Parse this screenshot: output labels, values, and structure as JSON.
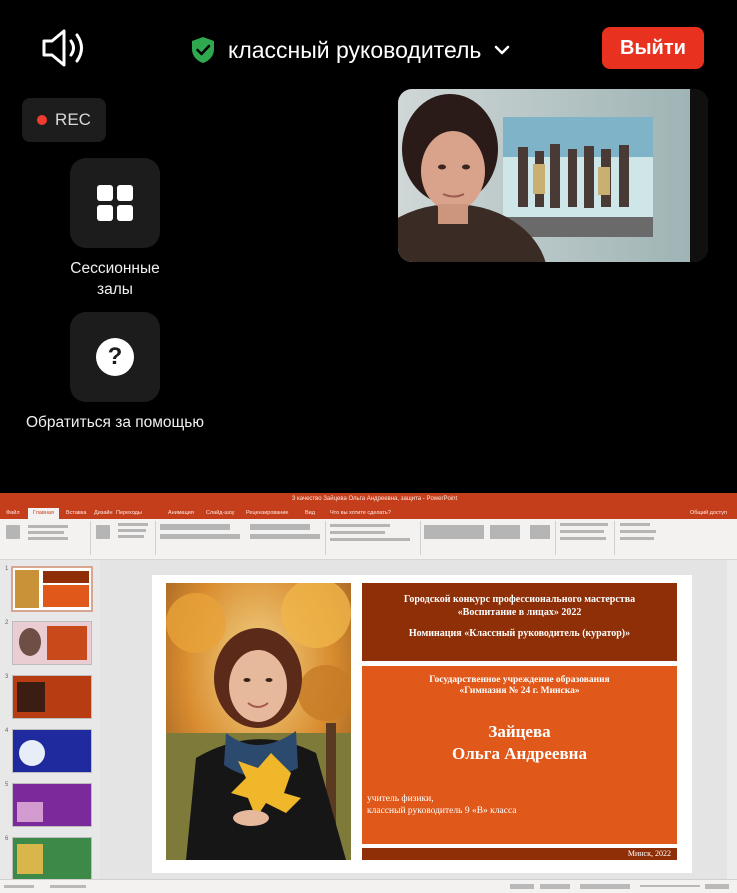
{
  "meeting": {
    "title": "классный руководитель",
    "exit_label": "Выйти",
    "rec_label": "REC",
    "breakout_label": "Сессионные залы",
    "help_label": "Обратиться за помощью",
    "help_glyph": "?",
    "icons": [
      "speaker-icon",
      "shield-check-icon",
      "chevron-down-icon",
      "grid-icon",
      "question-icon"
    ]
  },
  "colors": {
    "exit": "#e8321f",
    "rec_dot": "#f23c2e",
    "shield": "#2fa84f",
    "pp_accent": "#c43e1c",
    "slide_dark": "#8e2f08",
    "slide_orange": "#e0591a"
  },
  "powerpoint": {
    "window_title": "3 качество Зайцева Ольга Андреевна, защита  -  PowerPoint",
    "tabs": [
      "Файл",
      "Главная",
      "Вставка",
      "Дизайн",
      "Переходы",
      "Анимация",
      "Слайд-шоу",
      "Рецензирование",
      "Вид",
      "Что вы хотите сделать?"
    ],
    "share_label": "Общий доступ",
    "slide_numbers": [
      "1",
      "2",
      "3",
      "4",
      "5",
      "6"
    ]
  },
  "slide": {
    "contest_line1": "Городской конкурс профессионального мастерства",
    "contest_line2": "«Воспитание в лицах» 2022",
    "nomination": "Номинация «Классный руководитель (куратор)»",
    "institution_line1": "Государственное учреждение образования",
    "institution_line2": "«Гимназия № 24 г. Минска»",
    "surname": "Зайцева",
    "name": "Ольга Андреевна",
    "role_line1": "учитель физики,",
    "role_line2": "классный руководитель  9 «В» класса",
    "footer": "Минск, 2022"
  }
}
